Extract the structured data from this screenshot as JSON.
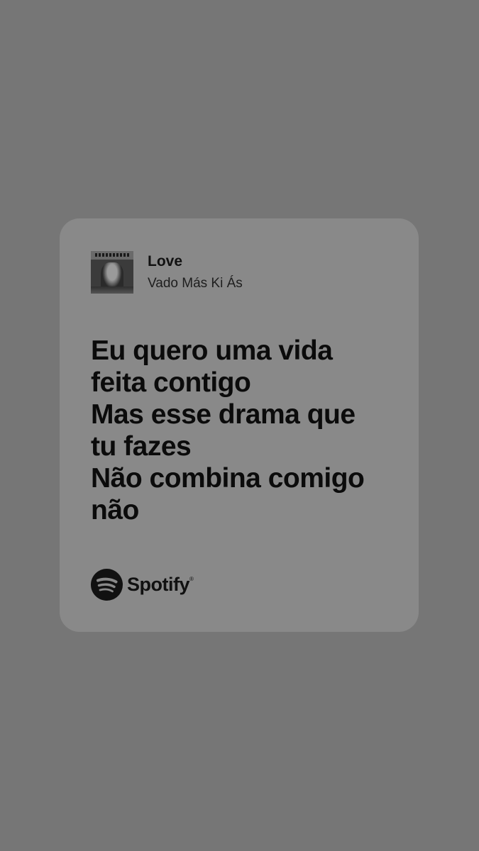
{
  "track": {
    "title": "Love",
    "artist": "Vado Más Ki Ás",
    "album_art_icon": "album-cover"
  },
  "lyrics": [
    "Eu quero uma vida",
    "feita contigo",
    "Mas esse drama que",
    "tu fazes",
    "Não combina comigo",
    "não"
  ],
  "brand": {
    "name": "Spotify",
    "icon": "spotify-logo-icon"
  },
  "colors": {
    "background": "#767676",
    "card": "#898989",
    "text": "#0b0b0b"
  }
}
